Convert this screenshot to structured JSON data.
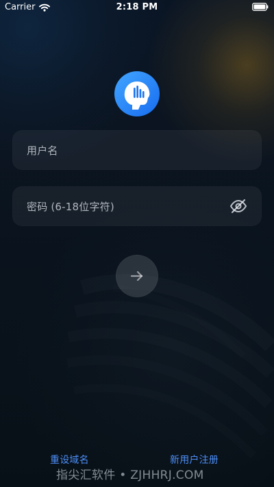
{
  "status_bar": {
    "carrier": "Carrier",
    "time": "2:18 PM",
    "wifi_icon": "wifi-icon",
    "battery_icon": "battery-icon"
  },
  "logo": {
    "icon": "voice-head-logo-icon",
    "brand_color": "#2c84f1"
  },
  "form": {
    "username_placeholder": "用户名",
    "password_placeholder": "密码 (6-18位字符)",
    "password_visibility_icon": "eye-off-icon",
    "submit_icon": "arrow-right-icon"
  },
  "links": {
    "reset_domain": "重设域名",
    "register": "新用户注册",
    "accent_color": "#4d8ef7"
  },
  "watermark": {
    "text": "指尖汇软件 • ZJHHRJ.COM"
  }
}
